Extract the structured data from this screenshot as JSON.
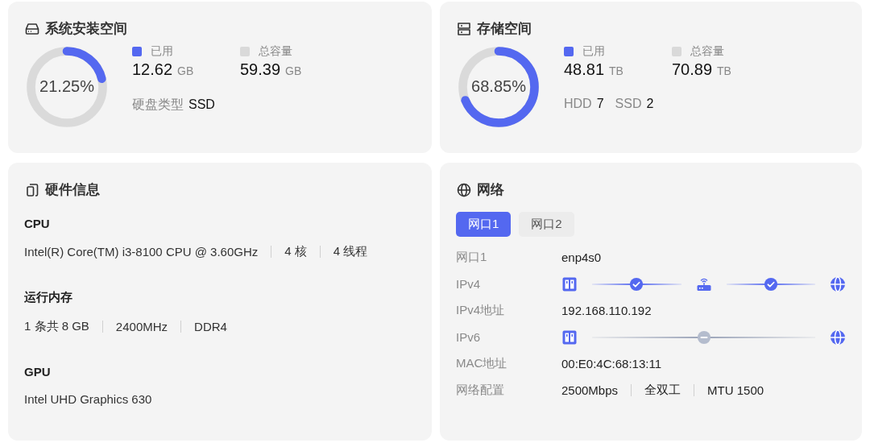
{
  "storage_cards": [
    {
      "kind": "drive",
      "title": "系统安装空间",
      "level": 0.2125,
      "percent": "21.25%",
      "used": {
        "label": "已用",
        "value": "12.62",
        "unit": "GB"
      },
      "total": {
        "label": "总容量",
        "value": "59.39",
        "unit": "GB"
      },
      "details": [
        {
          "label": "硬盘类型",
          "value": "SSD"
        }
      ]
    },
    {
      "kind": "server",
      "title": "存储空间",
      "level": 0.6885,
      "percent": "68.85%",
      "used": {
        "label": "已用",
        "value": "48.81",
        "unit": "TB"
      },
      "total": {
        "label": "总容量",
        "value": "70.89",
        "unit": "TB"
      },
      "details": [
        {
          "label": "HDD",
          "value": "7"
        },
        {
          "label": "SSD",
          "value": "2"
        }
      ]
    }
  ],
  "hardware": {
    "title": "硬件信息",
    "sections": [
      {
        "title": "CPU",
        "values": [
          "Intel(R) Core(TM) i3-8100 CPU @ 3.60GHz",
          "4 核",
          "4 线程"
        ]
      },
      {
        "title": "运行内存",
        "values": [
          "1 条共 8 GB",
          "2400MHz",
          "DDR4"
        ]
      },
      {
        "title": "GPU",
        "values": [
          "Intel UHD Graphics 630"
        ]
      }
    ]
  },
  "network": {
    "title": "网络",
    "tabs": [
      {
        "label": "网口1",
        "selected": true
      },
      {
        "label": "网口2",
        "selected": false
      }
    ],
    "rows": [
      {
        "kind": "text",
        "label": "网口1",
        "values": [
          "enp4s0"
        ]
      },
      {
        "kind": "path",
        "label": "IPv4",
        "nodes": [
          {
            "kind": "nas"
          },
          {
            "kind": "router"
          },
          {
            "kind": "globe"
          }
        ],
        "links": [
          {
            "connected": true
          },
          {
            "connected": true
          }
        ]
      },
      {
        "kind": "text",
        "label": "IPv4地址",
        "values": [
          "192.168.110.192"
        ]
      },
      {
        "kind": "path",
        "label": "IPv6",
        "nodes": [
          {
            "kind": "nas"
          },
          {
            "kind": "globe"
          }
        ],
        "links": [
          {
            "connected": false
          }
        ]
      },
      {
        "kind": "text",
        "label": "MAC地址",
        "values": [
          "00:E0:4C:68:13:11"
        ]
      },
      {
        "kind": "text",
        "label": "网络配置",
        "values": [
          "2500Mbps",
          "全双工",
          "MTU 1500"
        ]
      }
    ]
  }
}
